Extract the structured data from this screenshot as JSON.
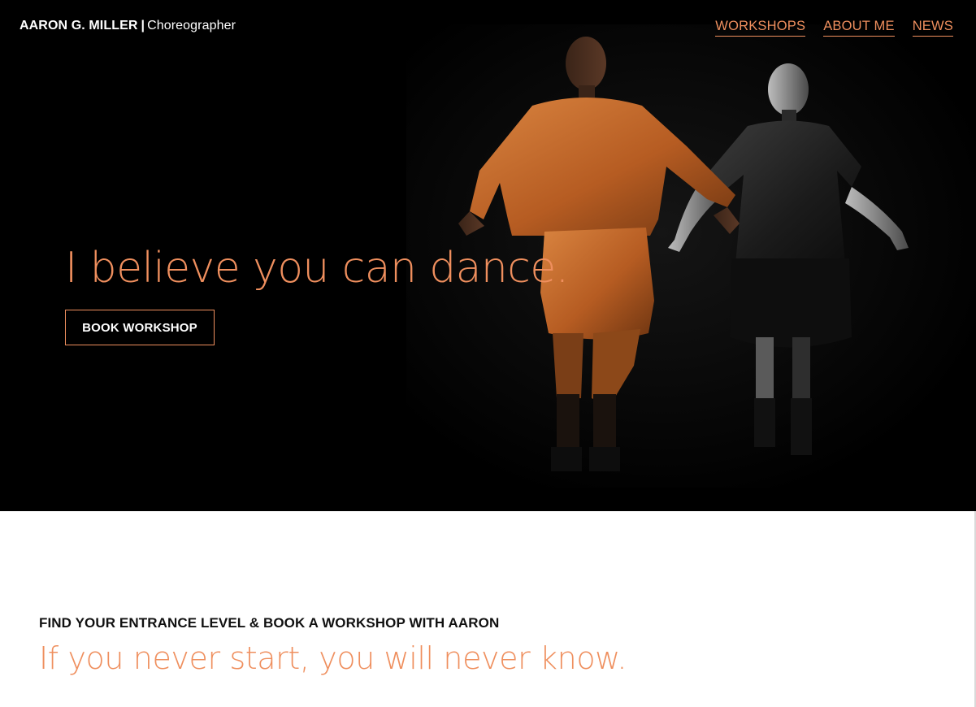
{
  "header": {
    "brand_name": "AARON G. MILLER",
    "brand_separator": "|",
    "brand_role": "Choreographer",
    "nav": [
      {
        "label": "WORKSHOPS"
      },
      {
        "label": "ABOUT ME"
      },
      {
        "label": "NEWS"
      }
    ]
  },
  "hero": {
    "title": "I believe you can dance.",
    "cta_label": "BOOK WORKSHOP",
    "photo_icon": "two-dancers-photo"
  },
  "section": {
    "kicker": "FIND YOUR ENTRANCE LEVEL & BOOK A WORKSHOP WITH AARON",
    "title": "If you never start, you will never know."
  },
  "colors": {
    "accent": "#ef8f5e",
    "hero_background": "#000000",
    "page_background": "#ffffff",
    "heading_text": "#111111"
  }
}
